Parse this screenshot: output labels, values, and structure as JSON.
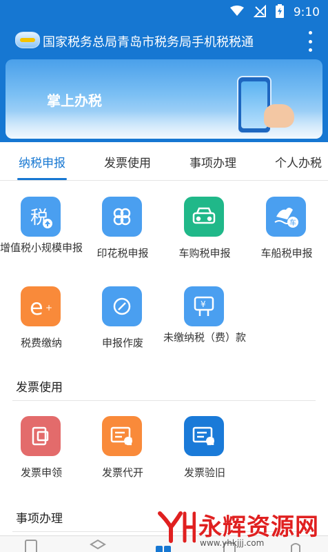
{
  "status_bar": {
    "time": "9:10",
    "icons": [
      "wifi-icon",
      "signal-icon",
      "battery-icon"
    ]
  },
  "app_bar": {
    "title": "国家税务总局青岛市税务局手机税税通",
    "more_icon": "more-vertical-icon"
  },
  "banner": {
    "text": "掌上办税"
  },
  "tabs": [
    {
      "label": "纳税申报",
      "active": true
    },
    {
      "label": "发票使用",
      "active": false
    },
    {
      "label": "事项办理",
      "active": false
    },
    {
      "label": "个人办税",
      "active": false
    }
  ],
  "filing": {
    "items": [
      {
        "label": "增值税小规模申报",
        "icon": "tax-upload-icon",
        "color": "#4a9ff0"
      },
      {
        "label": "印花税申报",
        "icon": "clover-icon",
        "color": "#4a9ff0"
      },
      {
        "label": "车购税申报",
        "icon": "car-icon",
        "color": "#20b889"
      },
      {
        "label": "车船税申报",
        "icon": "ship-car-icon",
        "color": "#4a9ff0"
      },
      {
        "label": "税费缴纳",
        "icon": "e-payment-icon",
        "color": "#f98a3a"
      },
      {
        "label": "申报作废",
        "icon": "cancel-icon",
        "color": "#4a9ff0"
      },
      {
        "label": "未缴纳税（费）款",
        "icon": "unpaid-tax-icon",
        "color": "#4a9ff0"
      }
    ]
  },
  "invoice": {
    "title": "发票使用",
    "items": [
      {
        "label": "发票申领",
        "icon": "invoice-apply-icon",
        "color": "#e36b6b"
      },
      {
        "label": "发票代开",
        "icon": "invoice-issue-icon",
        "color": "#f98a3a"
      },
      {
        "label": "发票验旧",
        "icon": "invoice-verify-icon",
        "color": "#1a7ad8"
      }
    ]
  },
  "matters": {
    "title": "事项办理"
  },
  "watermark": {
    "text": "永辉资源网",
    "url": "www.yhkjjj.com"
  },
  "bottom_nav": {
    "icons": [
      "document-icon",
      "box-icon",
      "grid-icon",
      "square-icon",
      "person-icon"
    ]
  }
}
